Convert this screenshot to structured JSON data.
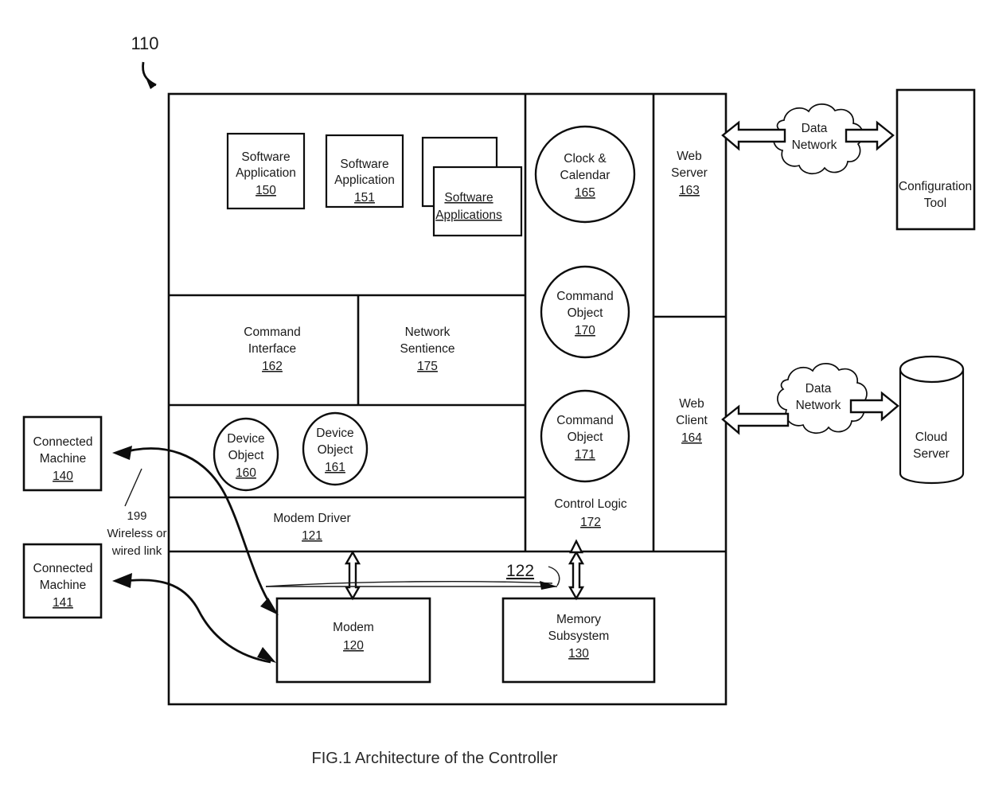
{
  "figure": {
    "caption": "FIG.1 Architecture of the Controller",
    "controller_ref": "110"
  },
  "controller": {
    "software_applications": [
      {
        "name_line1": "Software",
        "name_line2": "Application",
        "ref": "150"
      },
      {
        "name_line1": "Software",
        "name_line2": "Application",
        "ref": "151"
      },
      {
        "name_line1": "Software",
        "name_line2": "Applications",
        "ref": ""
      }
    ],
    "middleware": [
      {
        "name_line1": "Command",
        "name_line2": "Interface",
        "ref": "162"
      },
      {
        "name_line1": "Network",
        "name_line2": "Sentience",
        "ref": "175"
      }
    ],
    "device_objects": [
      {
        "name_line1": "Device",
        "name_line2": "Object",
        "ref": "160"
      },
      {
        "name_line1": "Device",
        "name_line2": "Object",
        "ref": "161"
      }
    ],
    "modem_driver": {
      "name": "Modem Driver",
      "ref": "121"
    },
    "control_logic": {
      "name": "Control Logic",
      "ref": "172",
      "objects": [
        {
          "name_line1": "Clock &",
          "name_line2": "Calendar",
          "ref": "165"
        },
        {
          "name_line1": "Command",
          "name_line2": "Object",
          "ref": "170"
        },
        {
          "name_line1": "Command",
          "name_line2": "Object",
          "ref": "171"
        }
      ]
    },
    "web_stack": [
      {
        "name_line1": "Web",
        "name_line2": "Server",
        "ref": "163"
      },
      {
        "name_line1": "Web",
        "name_line2": "Client",
        "ref": "164"
      }
    ],
    "hardware": [
      {
        "name_line1": "Modem",
        "name_line2": "",
        "ref": "120"
      },
      {
        "name_line1": "Memory",
        "name_line2": "Subsystem",
        "ref": "130"
      }
    ],
    "bus_ref": "122"
  },
  "external": {
    "clouds": [
      {
        "line1": "Data",
        "line2": "Network"
      },
      {
        "line1": "Data",
        "line2": "Network"
      }
    ],
    "configuration_tool": {
      "line1": "Configuration",
      "line2": "Tool"
    },
    "cloud_server": {
      "line1": "Cloud",
      "line2": "Server"
    },
    "connected_machines": [
      {
        "line1": "Connected",
        "line2": "Machine",
        "ref": "140"
      },
      {
        "line1": "Connected",
        "line2": "Machine",
        "ref": "141"
      }
    ],
    "link_annotation": {
      "ref": "199",
      "line1": "Wireless or",
      "line2": "wired link"
    }
  },
  "colors": {
    "ink": "#0d0d0d",
    "paper": "#ffffff"
  }
}
